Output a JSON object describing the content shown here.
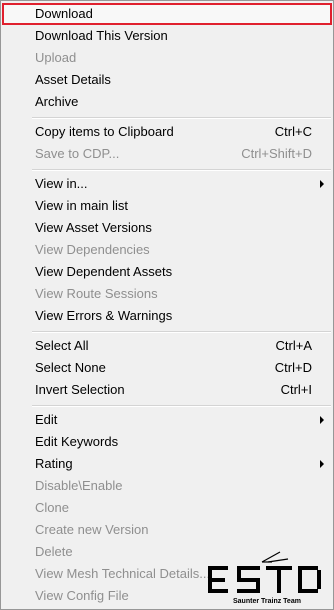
{
  "menu": {
    "items": [
      {
        "label": "Download",
        "shortcut": ""
      },
      {
        "label": "Download This Version",
        "shortcut": ""
      },
      {
        "label": "Upload",
        "shortcut": ""
      },
      {
        "label": "Asset Details",
        "shortcut": ""
      },
      {
        "label": "Archive",
        "shortcut": ""
      },
      {
        "label": "Copy items to Clipboard",
        "shortcut": "Ctrl+C"
      },
      {
        "label": "Save to CDP...",
        "shortcut": "Ctrl+Shift+D"
      },
      {
        "label": "View in...",
        "shortcut": ""
      },
      {
        "label": "View in main list",
        "shortcut": ""
      },
      {
        "label": "View Asset Versions",
        "shortcut": ""
      },
      {
        "label": "View Dependencies",
        "shortcut": ""
      },
      {
        "label": "View Dependent Assets",
        "shortcut": ""
      },
      {
        "label": "View Route Sessions",
        "shortcut": ""
      },
      {
        "label": "View Errors & Warnings",
        "shortcut": ""
      },
      {
        "label": "Select All",
        "shortcut": "Ctrl+A"
      },
      {
        "label": "Select None",
        "shortcut": "Ctrl+D"
      },
      {
        "label": "Invert Selection",
        "shortcut": "Ctrl+I"
      },
      {
        "label": "Edit",
        "shortcut": ""
      },
      {
        "label": "Edit Keywords",
        "shortcut": ""
      },
      {
        "label": "Rating",
        "shortcut": ""
      },
      {
        "label": "Disable\\Enable",
        "shortcut": ""
      },
      {
        "label": "Clone",
        "shortcut": ""
      },
      {
        "label": "Create new Version",
        "shortcut": ""
      },
      {
        "label": "Delete",
        "shortcut": ""
      },
      {
        "label": "View Mesh Technical Details...",
        "shortcut": ""
      },
      {
        "label": "View Config File",
        "shortcut": ""
      }
    ]
  },
  "watermark": {
    "caption": "Saunter Trainz Team"
  },
  "colors": {
    "menu_background": "#f0f0f0",
    "highlight_border": "#e0202e",
    "disabled_text": "#8f8f8f"
  }
}
